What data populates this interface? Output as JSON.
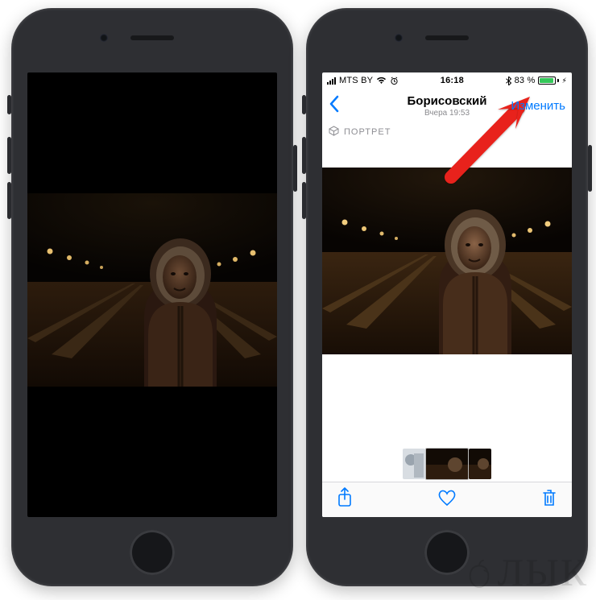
{
  "status": {
    "carrier": "MTS BY",
    "time": "16:18",
    "battery_text": "83 %",
    "battery_level": 0.83
  },
  "nav": {
    "title": "Борисовский",
    "subtitle": "Вчера 19:53",
    "edit_label": "Изменить"
  },
  "badge": {
    "portrait_label": "ПОРТРЕТ"
  },
  "colors": {
    "ios_blue": "#007aff",
    "arrow_red": "#e8231a"
  },
  "watermark": {
    "text": "ЛЫК"
  }
}
